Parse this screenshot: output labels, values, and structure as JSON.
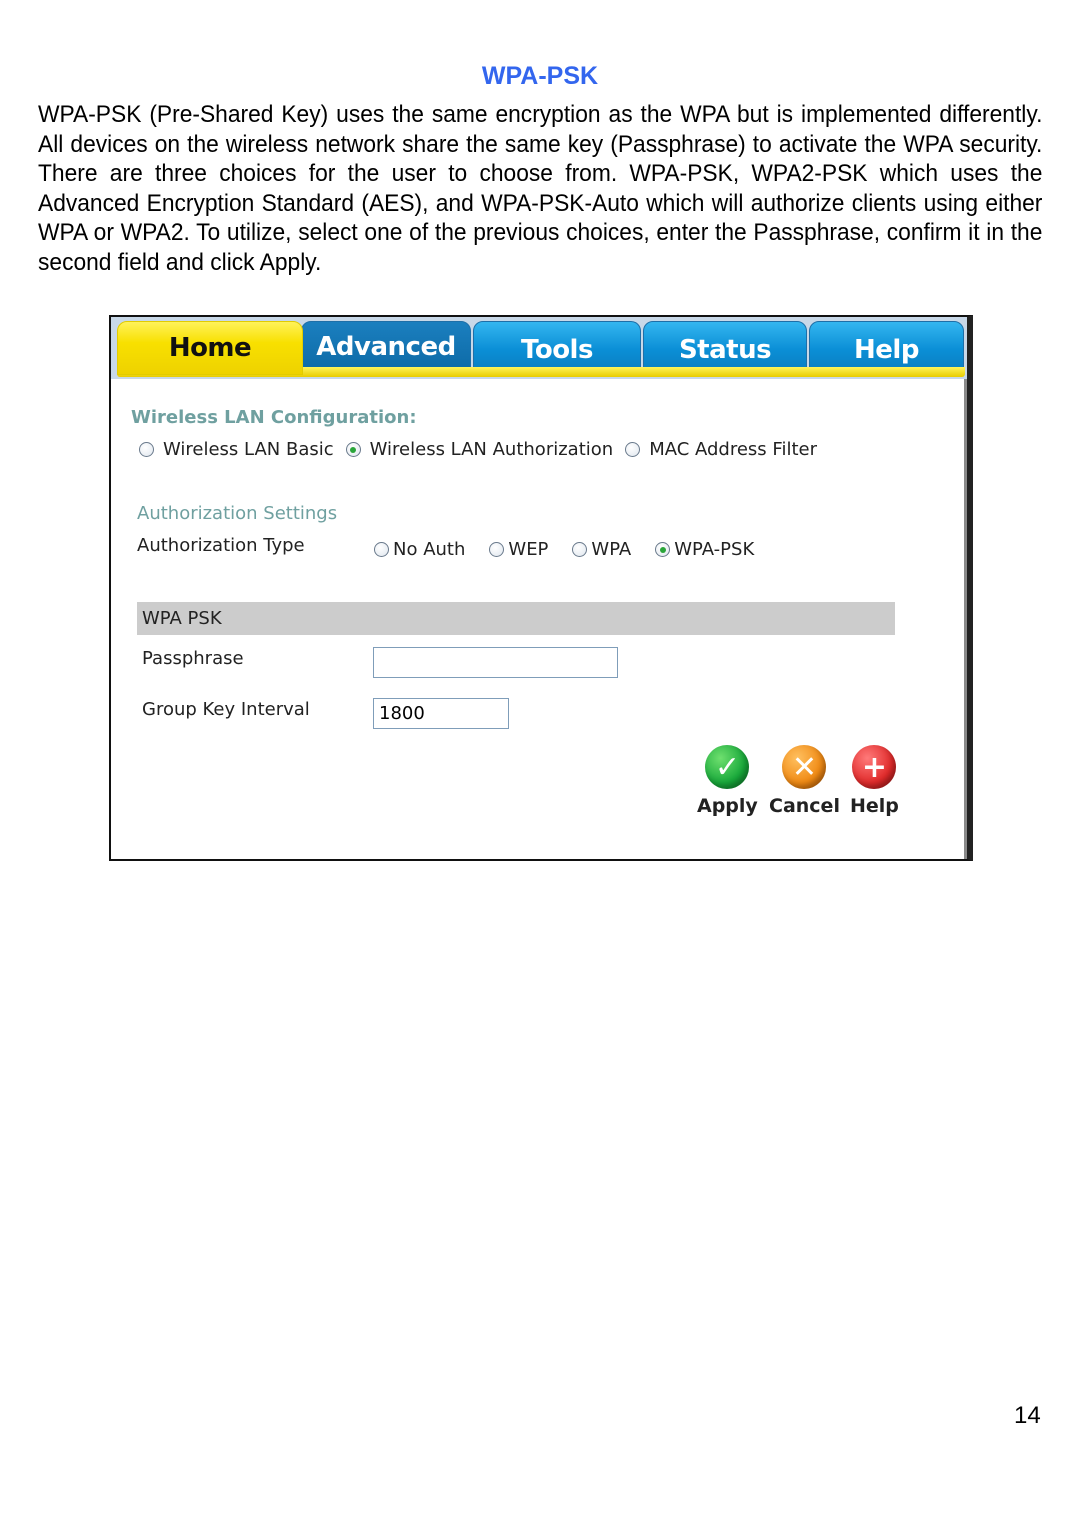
{
  "document": {
    "title": "WPA-PSK",
    "paragraph": "WPA-PSK (Pre-Shared Key) uses the same encryption as the WPA but is implemented differently. All devices on the wireless network share the same key (Passphrase) to activate the WPA security.  There are three choices for the user to choose from. WPA-PSK, WPA2-PSK which uses the Advanced Encryption Standard (AES), and WPA-PSK-Auto which will authorize clients using either WPA or WPA2. To utilize, select one of the previous choices, enter the Passphrase, confirm it in the second field and click Apply.",
    "page_number": "14",
    "title_color": "#3366ee"
  },
  "router_ui": {
    "tabs": [
      {
        "label": "Home",
        "active": true
      },
      {
        "label": "Advanced",
        "active": false
      },
      {
        "label": "Tools",
        "active": false
      },
      {
        "label": "Status",
        "active": false
      },
      {
        "label": "Help",
        "active": false
      }
    ],
    "wlan_config": {
      "title": "Wireless LAN Configuration:",
      "options": [
        {
          "label": "Wireless LAN Basic",
          "checked": false
        },
        {
          "label": "Wireless LAN Authorization",
          "checked": true
        },
        {
          "label": "MAC Address Filter",
          "checked": false
        }
      ]
    },
    "auth_settings": {
      "title": "Authorization Settings",
      "type_label": "Authorization Type",
      "options": [
        {
          "label": "No Auth",
          "checked": false
        },
        {
          "label": "WEP",
          "checked": false
        },
        {
          "label": "WPA",
          "checked": false
        },
        {
          "label": "WPA-PSK",
          "checked": true
        }
      ]
    },
    "wpa_psk": {
      "section_title": "WPA PSK",
      "passphrase_label": "Passphrase",
      "passphrase_value": "",
      "group_key_label": "Group Key Interval",
      "group_key_value": "1800"
    },
    "actions": {
      "apply": {
        "label": "Apply",
        "icon": "checkmark-icon"
      },
      "cancel": {
        "label": "Cancel",
        "icon": "x-icon"
      },
      "help": {
        "label": "Help",
        "icon": "plus-icon"
      }
    }
  }
}
